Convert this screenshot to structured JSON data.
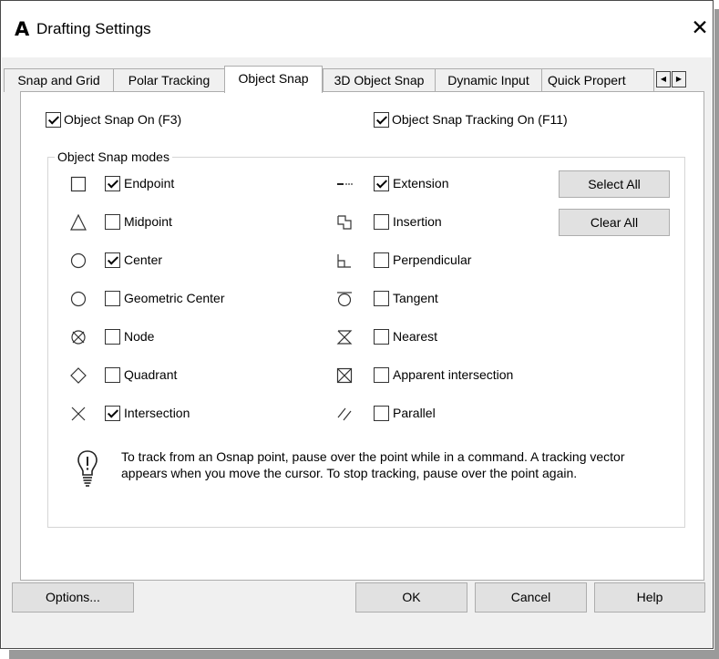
{
  "window": {
    "icon_letter": "A",
    "title": "Drafting Settings",
    "close_glyph": "✕"
  },
  "tabs": [
    {
      "label": "Snap and Grid",
      "active": false
    },
    {
      "label": "Polar Tracking",
      "active": false
    },
    {
      "label": "Object Snap",
      "active": true
    },
    {
      "label": "3D Object Snap",
      "active": false
    },
    {
      "label": "Dynamic Input",
      "active": false
    },
    {
      "label": "Quick Propert",
      "active": false
    }
  ],
  "tab_scroll": {
    "left_glyph": "◀",
    "right_glyph": "▶"
  },
  "object_snap_on": {
    "label": "Object Snap On (F3)",
    "checked": true
  },
  "tracking_on": {
    "label": "Object Snap Tracking On (F11)",
    "checked": true
  },
  "modes_group_title": "Object Snap modes",
  "modes_left": [
    {
      "label": "Endpoint",
      "checked": true,
      "icon": "endpoint-marker-icon"
    },
    {
      "label": "Midpoint",
      "checked": false,
      "icon": "midpoint-marker-icon"
    },
    {
      "label": "Center",
      "checked": true,
      "icon": "center-marker-icon"
    },
    {
      "label": "Geometric Center",
      "checked": false,
      "icon": "geometric-center-marker-icon"
    },
    {
      "label": "Node",
      "checked": false,
      "icon": "node-marker-icon"
    },
    {
      "label": "Quadrant",
      "checked": false,
      "icon": "quadrant-marker-icon"
    },
    {
      "label": "Intersection",
      "checked": true,
      "icon": "intersection-marker-icon"
    }
  ],
  "modes_right": [
    {
      "label": "Extension",
      "checked": true,
      "icon": "extension-marker-icon"
    },
    {
      "label": "Insertion",
      "checked": false,
      "icon": "insertion-marker-icon"
    },
    {
      "label": "Perpendicular",
      "checked": false,
      "icon": "perpendicular-marker-icon"
    },
    {
      "label": "Tangent",
      "checked": false,
      "icon": "tangent-marker-icon"
    },
    {
      "label": "Nearest",
      "checked": false,
      "icon": "nearest-marker-icon"
    },
    {
      "label": "Apparent intersection",
      "checked": false,
      "icon": "apparent-intersection-marker-icon"
    },
    {
      "label": "Parallel",
      "checked": false,
      "icon": "parallel-marker-icon"
    }
  ],
  "buttons": {
    "select_all": "Select All",
    "clear_all": "Clear All"
  },
  "hint_text": "To track from an Osnap point, pause over the point while in a command.  A tracking vector appears when you move the cursor.  To stop tracking, pause over the point again.",
  "footer": {
    "options": "Options...",
    "ok": "OK",
    "cancel": "Cancel",
    "help": "Help"
  }
}
